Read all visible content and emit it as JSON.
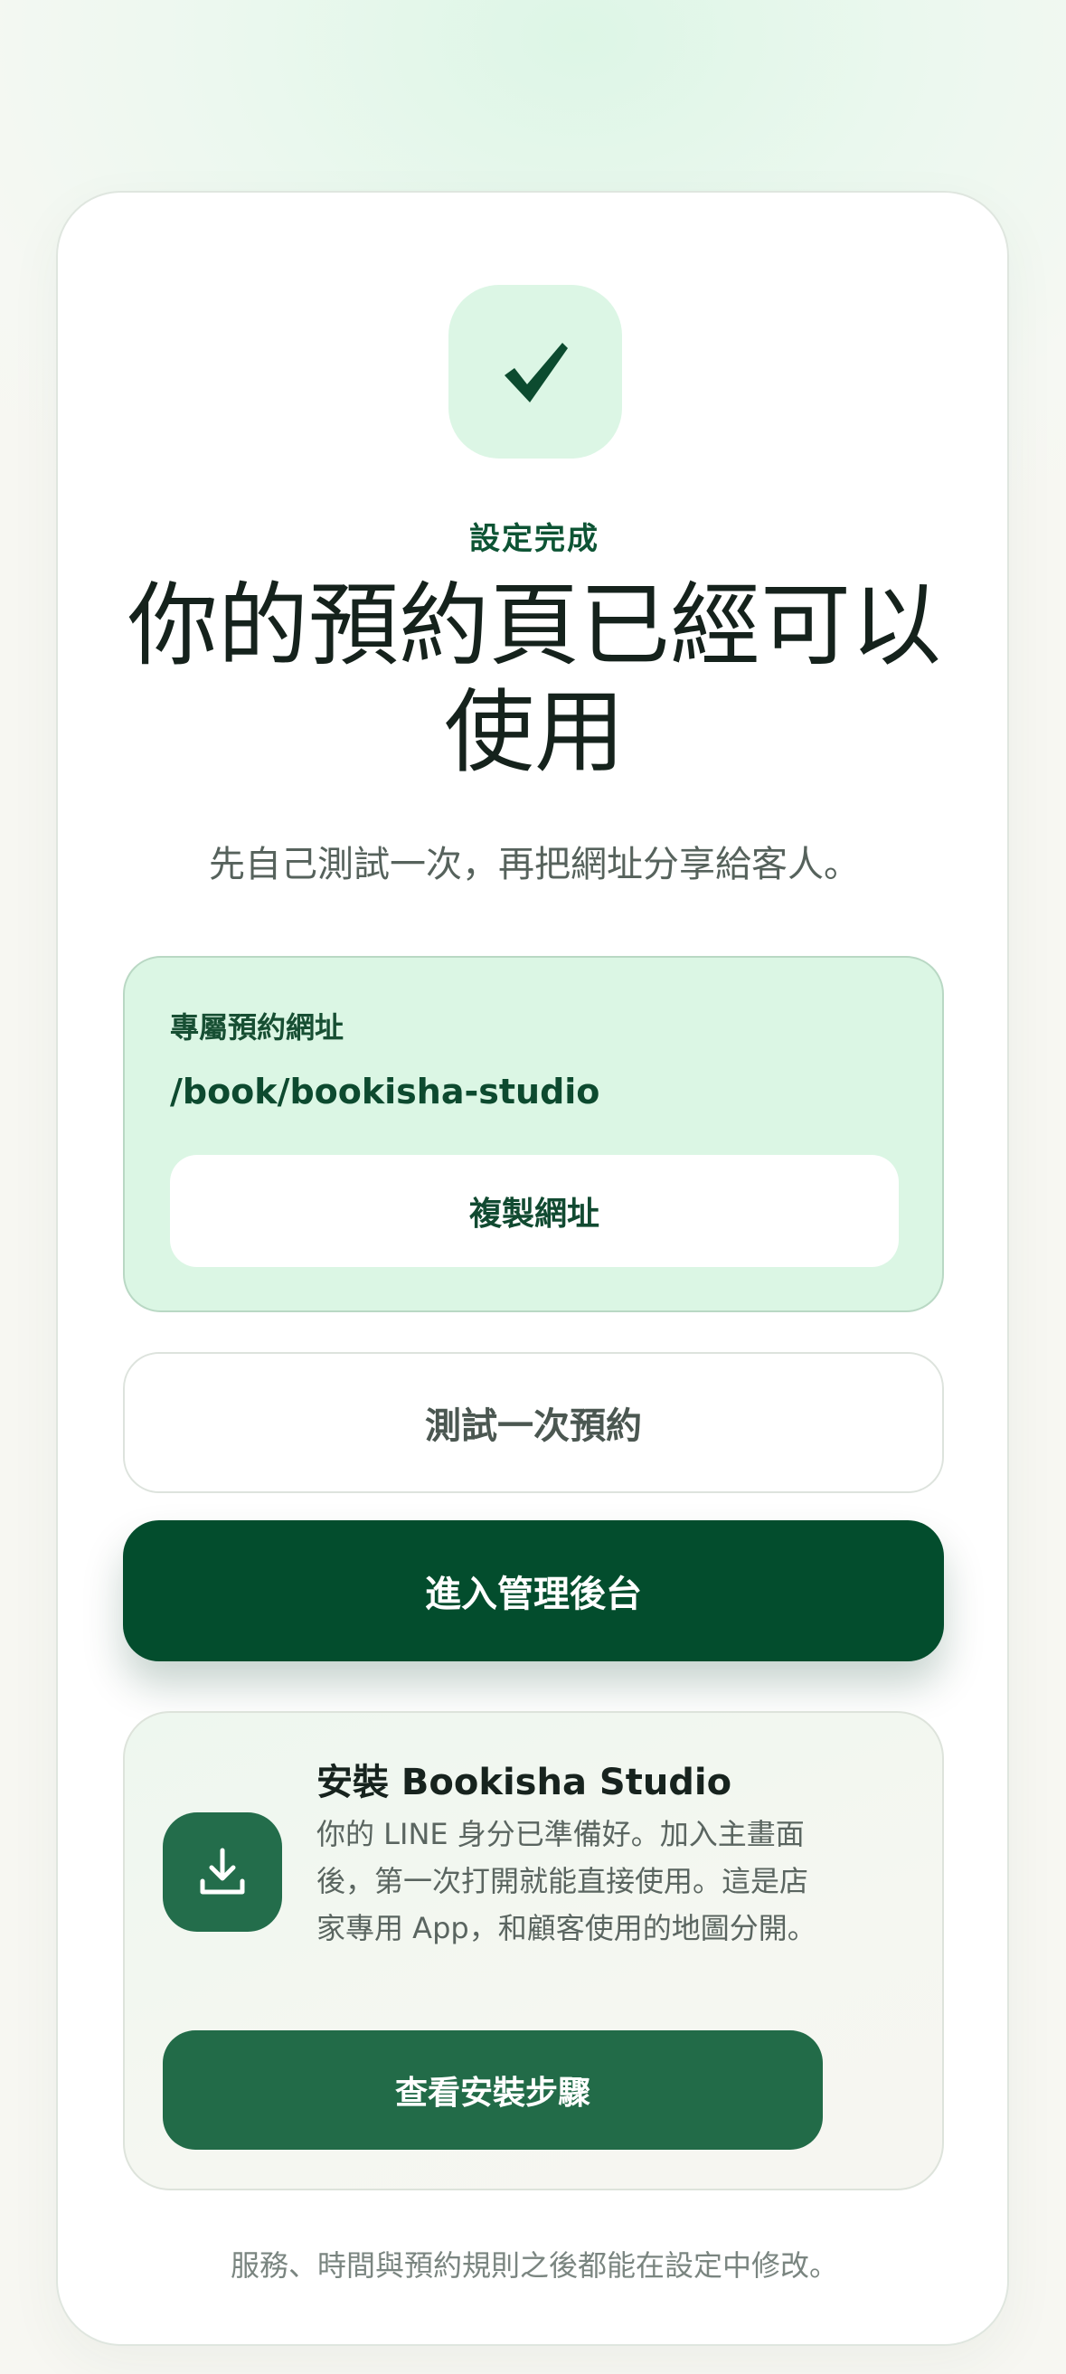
{
  "hero": {
    "icon": "checkmark-icon",
    "eyebrow": "設定完成",
    "title": "你的預約頁已經可以使用",
    "subtitle": "先自己測試一次，再把網址分享給客人。"
  },
  "url_panel": {
    "label": "專屬預約網址",
    "url": "/book/bookisha-studio",
    "copy_label": "複製網址"
  },
  "actions": {
    "test_label": "測試一次預約",
    "admin_label": "進入管理後台"
  },
  "install": {
    "icon": "download-icon",
    "title": "安裝 Bookisha Studio",
    "description": "你的 LINE 身分已準備好。加入主畫面後，第一次打開就能直接使用。這是店家專用 App，和顧客使用的地圖分開。",
    "button_label": "查看安裝步驟"
  },
  "footnote": "服務、時間與預約規則之後都能在設定中修改。",
  "colors": {
    "primary_dark": "#034d2d",
    "primary": "#236d4b",
    "mint": "#dbf6e4"
  }
}
